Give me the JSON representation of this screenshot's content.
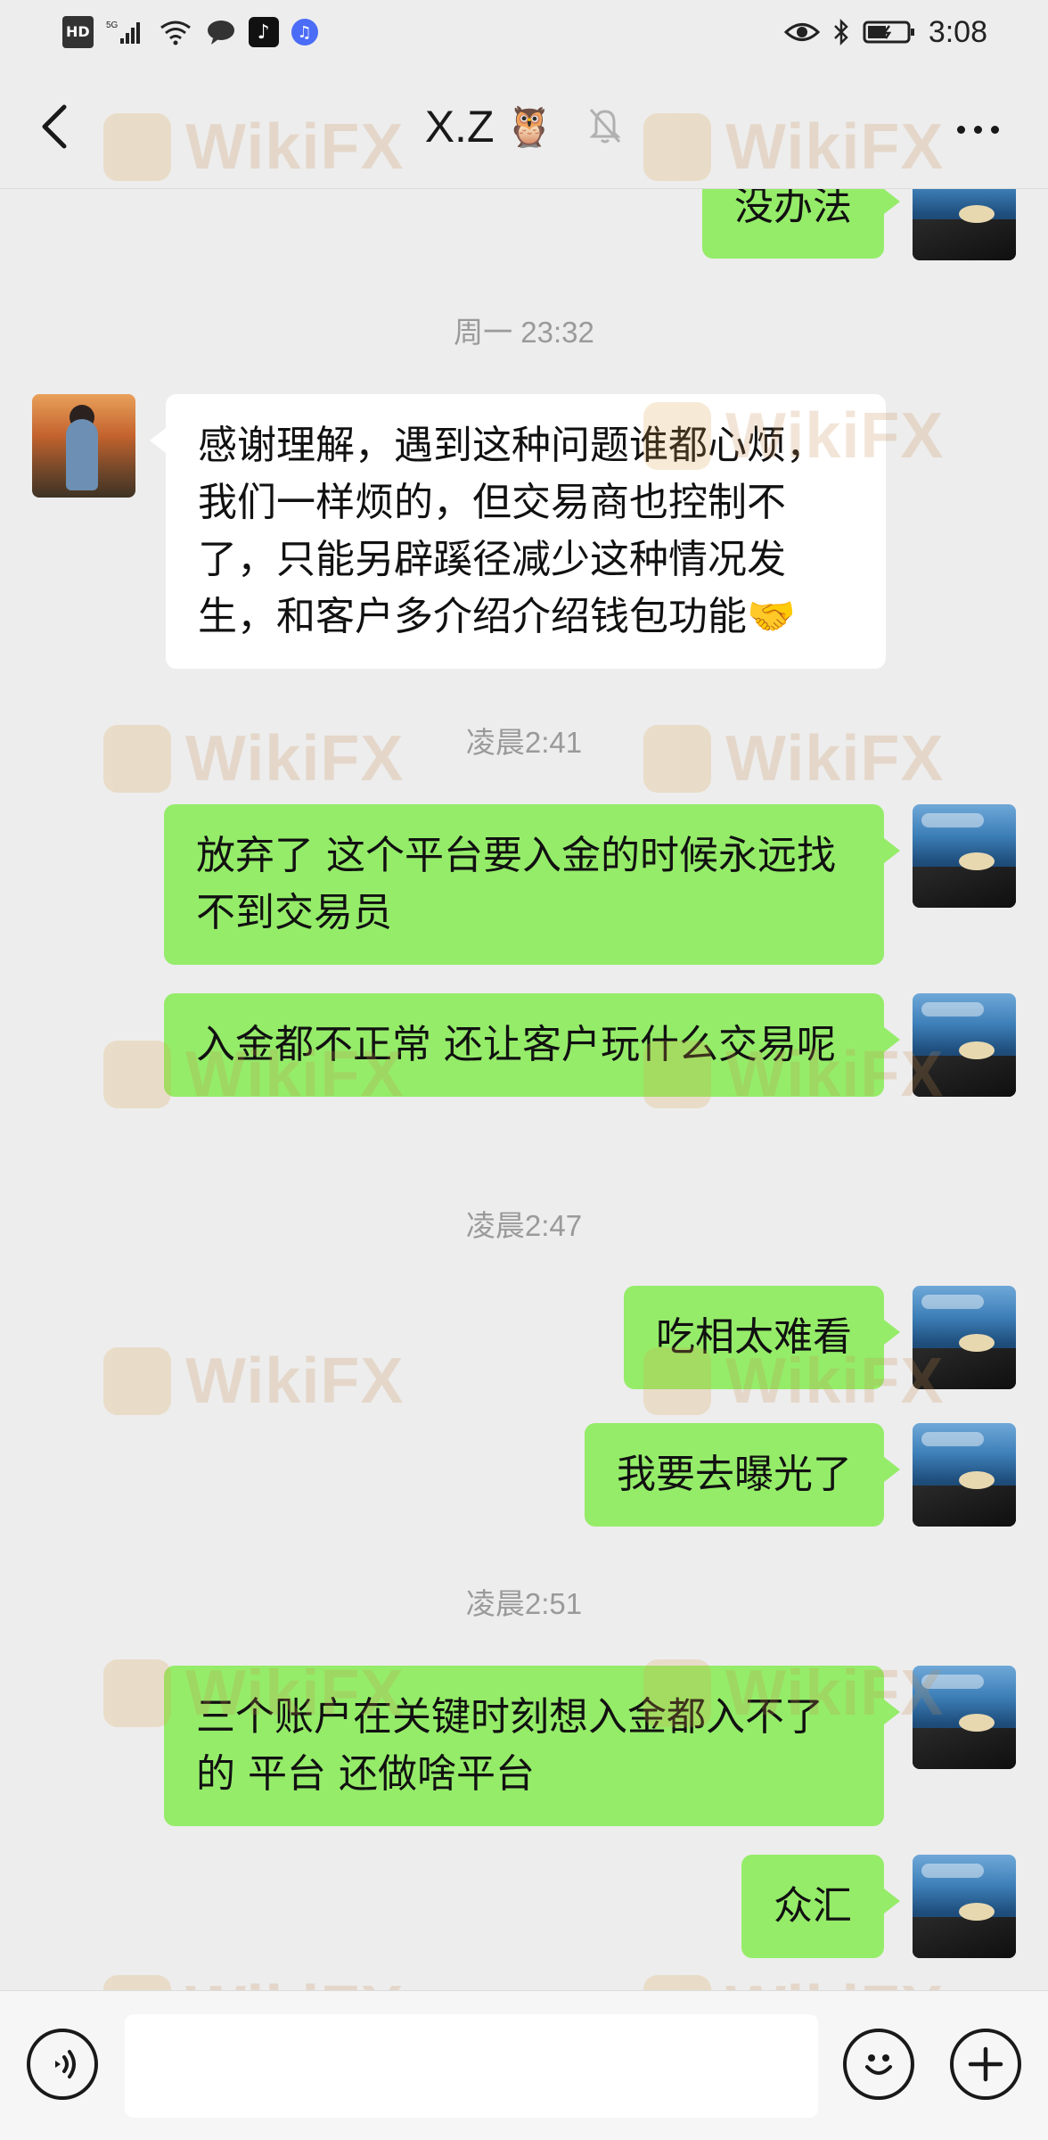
{
  "status_bar": {
    "hd": "HD",
    "network": "5G",
    "time": "3:08"
  },
  "header": {
    "title": "X.Z",
    "title_emoji": "🦉",
    "icons": [
      "back-icon",
      "mute-bell-icon",
      "more-icon"
    ]
  },
  "watermark": {
    "text": "WikiFX"
  },
  "messages": [
    {
      "type": "message",
      "from": "self",
      "text": "没办法"
    },
    {
      "type": "timestamp",
      "text": "周一 23:32"
    },
    {
      "type": "message",
      "from": "other",
      "text": "感谢理解，遇到这种问题谁都心烦，我们一样烦的，但交易商也控制不了，只能另辟蹊径减少这种情况发生，和客户多介绍介绍钱包功能🤝"
    },
    {
      "type": "timestamp",
      "text": "凌晨2:41"
    },
    {
      "type": "message",
      "from": "self",
      "text": "放弃了 这个平台要入金的时候永远找不到交易员"
    },
    {
      "type": "message",
      "from": "self",
      "text": "入金都不正常 还让客户玩什么交易呢"
    },
    {
      "type": "timestamp",
      "text": "凌晨2:47"
    },
    {
      "type": "message",
      "from": "self",
      "text": "吃相太难看"
    },
    {
      "type": "message",
      "from": "self",
      "text": "我要去曝光了"
    },
    {
      "type": "timestamp",
      "text": "凌晨2:51"
    },
    {
      "type": "message",
      "from": "self",
      "text": "三个账户在关键时刻想入金都入不了的 平台 还做啥平台"
    },
    {
      "type": "message",
      "from": "self",
      "text": "众汇"
    }
  ],
  "input_bar": {
    "placeholder": "",
    "icons": [
      "voice-icon",
      "emoji-icon",
      "plus-icon"
    ]
  },
  "colors": {
    "self_bubble": "#95ec69",
    "other_bubble": "#ffffff",
    "background": "#ededed"
  }
}
